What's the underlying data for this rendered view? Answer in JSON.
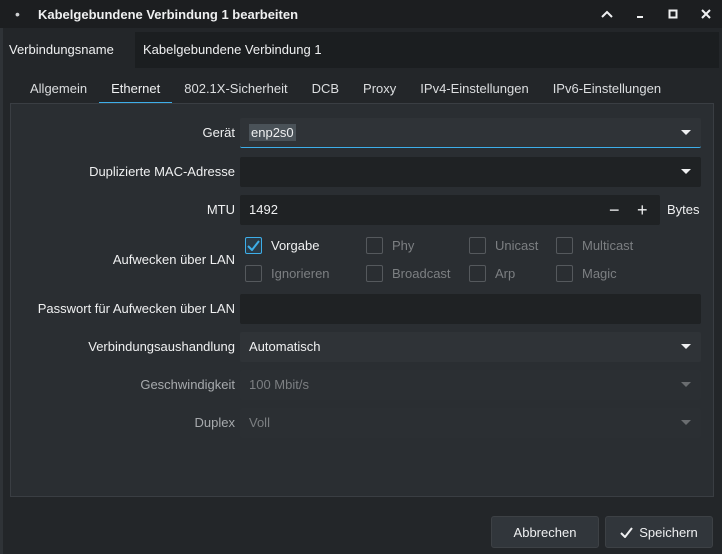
{
  "window": {
    "title": "Kabelgebundene Verbindung 1 bearbeiten",
    "buttons": [
      "minimize-icon",
      "maximize-icon",
      "close-icon"
    ]
  },
  "connection": {
    "name_label": "Verbindungsname",
    "name_value": "Kabelgebundene Verbindung 1"
  },
  "tabs": [
    {
      "label": "Allgemein",
      "active": false
    },
    {
      "label": "Ethernet",
      "active": true
    },
    {
      "label": "802.1X-Sicherheit",
      "active": false
    },
    {
      "label": "DCB",
      "active": false
    },
    {
      "label": "Proxy",
      "active": false
    },
    {
      "label": "IPv4-Einstellungen",
      "active": false
    },
    {
      "label": "IPv6-Einstellungen",
      "active": false
    }
  ],
  "form": {
    "device_label": "Gerät",
    "device_value": "enp2s0",
    "mac_label": "Duplizierte MAC-Adresse",
    "mac_value": "",
    "mtu_label": "MTU",
    "mtu_value": "1492",
    "mtu_minus": "−",
    "mtu_plus": "+",
    "mtu_units": "Bytes",
    "wol_label": "Aufwecken über LAN",
    "wol_options": [
      {
        "label": "Vorgabe",
        "checked": true
      },
      {
        "label": "Phy",
        "checked": false
      },
      {
        "label": "Unicast",
        "checked": false
      },
      {
        "label": "Multicast",
        "checked": false
      },
      {
        "label": "Ignorieren",
        "checked": false
      },
      {
        "label": "Broadcast",
        "checked": false
      },
      {
        "label": "Arp",
        "checked": false
      },
      {
        "label": "Magic",
        "checked": false
      }
    ],
    "wol_password_label": "Passwort für Aufwecken über LAN",
    "wol_password_value": "",
    "negotiation_label": "Verbindungsaushandlung",
    "negotiation_value": "Automatisch",
    "speed_label": "Geschwindigkeit",
    "speed_value": "100 Mbit/s",
    "duplex_label": "Duplex",
    "duplex_value": "Voll"
  },
  "footer": {
    "cancel_label": "Abbrechen",
    "save_label": "Speichern"
  },
  "colors": {
    "accent": "#3daee9",
    "background": "#232629",
    "panel": "#2a2e32"
  }
}
